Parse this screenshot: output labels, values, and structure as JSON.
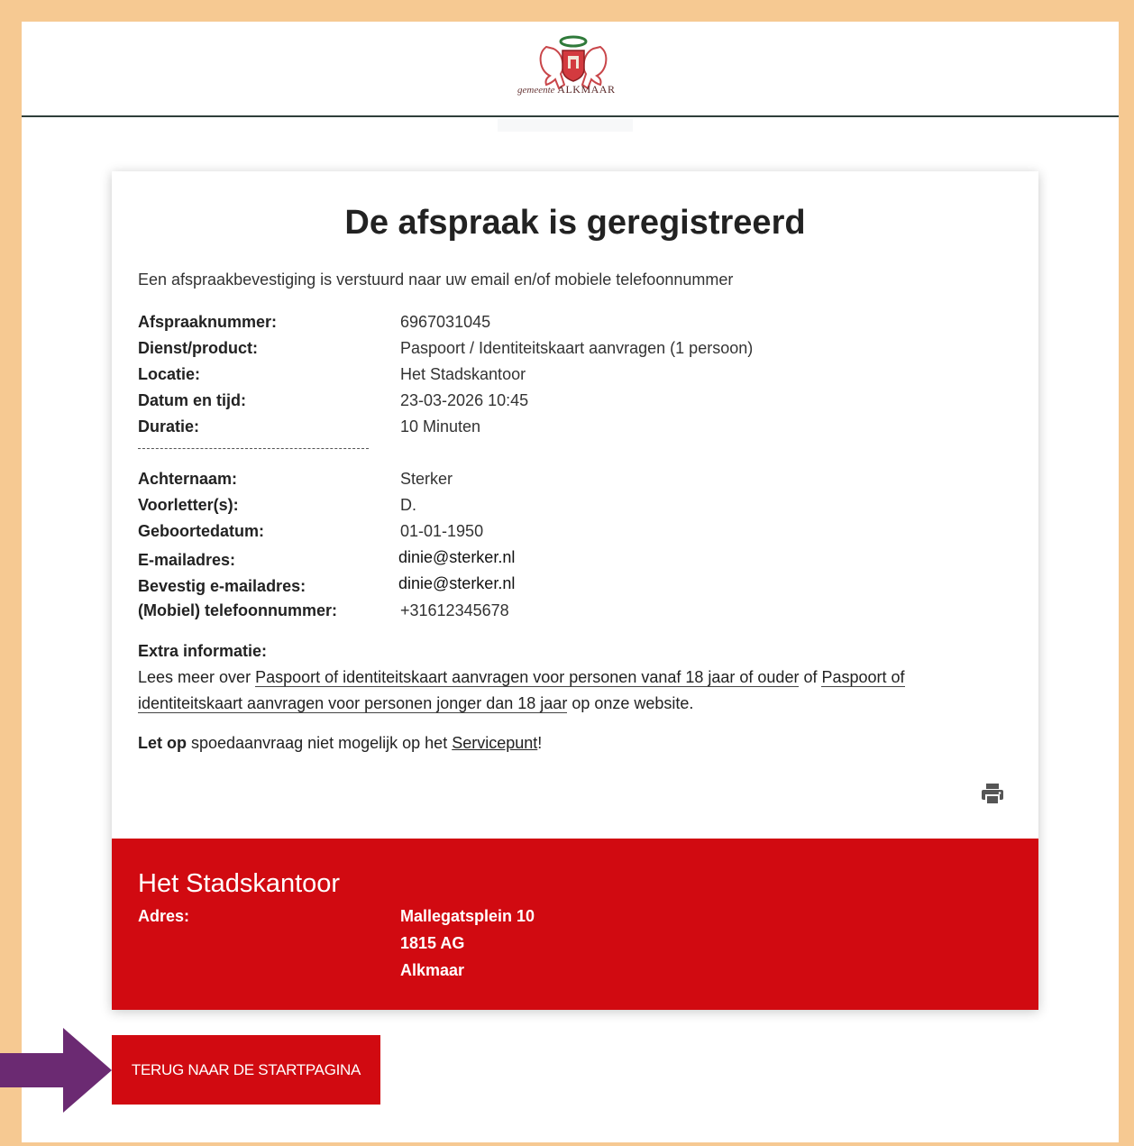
{
  "logo": {
    "municipality": "gemeente",
    "city": "ALKMAAR"
  },
  "title": "De afspraak is geregistreerd",
  "intro": "Een afspraakbevestiging is verstuurd naar uw email en/of mobiele telefoonnummer",
  "appointment": [
    {
      "label": "Afspraaknummer:",
      "value": "6967031045"
    },
    {
      "label": "Dienst/product:",
      "value": "Paspoort / Identiteitskaart aanvragen (1 persoon)"
    },
    {
      "label": "Locatie:",
      "value": "Het Stadskantoor"
    },
    {
      "label": "Datum en tijd:",
      "value": "23-03-2026 10:45"
    },
    {
      "label": "Duratie:",
      "value": "10 Minuten"
    }
  ],
  "personal": [
    {
      "label": "Achternaam:",
      "value": "Sterker"
    },
    {
      "label": "Voorletter(s):",
      "value": "D."
    },
    {
      "label": "Geboortedatum:",
      "value": "01-01-1950"
    },
    {
      "label": "E-mailadres:",
      "value": "dinie@sterker.nl"
    },
    {
      "label": "Bevestig e-mailadres:",
      "value": "dinie@sterker.nl"
    },
    {
      "label": "(Mobiel) telefoonnummer:",
      "value": "+31612345678"
    }
  ],
  "extra": {
    "heading": "Extra informatie:",
    "prefix": "Lees meer over ",
    "link1": "Paspoort of identiteitskaart aanvragen voor personen vanaf 18 jaar of ouder",
    "middle": " of ",
    "link2": "Paspoort of identiteitskaart aanvragen voor personen jonger dan 18 jaar",
    "suffix": " op onze website."
  },
  "note": {
    "bold": "Let op",
    "text": " spoedaanvraag niet mogelijk op het ",
    "link": "Servicepunt",
    "end": "!"
  },
  "print_icon": "printer-icon",
  "address": {
    "title": "Het Stadskantoor",
    "label": "Adres:",
    "street": "Mallegatsplein 10",
    "postcode": "1815 AG",
    "city": "Alkmaar"
  },
  "back_button": "TERUG NAAR DE STARTPAGINA",
  "colors": {
    "accent_red": "#d10a11",
    "frame": "#f6c992",
    "arrow": "#6b2a72"
  }
}
